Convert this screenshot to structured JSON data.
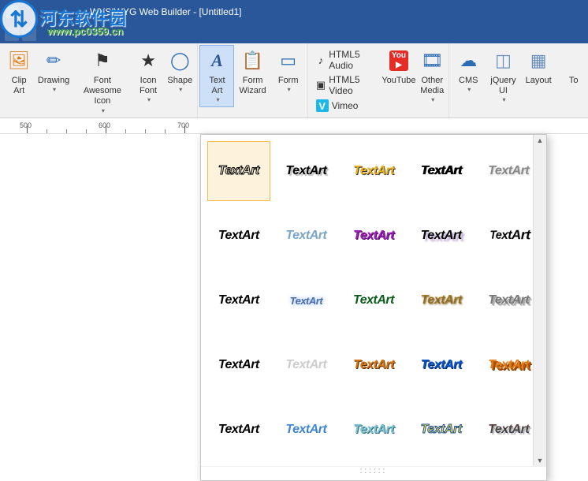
{
  "app": {
    "title": "WYSIWYG Web Builder - [Untitled1]"
  },
  "watermark": {
    "text": "河东软件园",
    "url": "www.pc0359.cn"
  },
  "ribbon": {
    "drawing_group": "Drawing",
    "clip_art": "Clip\nArt",
    "drawing": "Drawing",
    "font_awesome": "Font Awesome\nIcon",
    "icon_font": "Icon\nFont",
    "shape": "Shape",
    "text_art": "Text\nArt",
    "form_wizard": "Form\nWizard",
    "form": "Form",
    "html5_audio": "HTML5 Audio",
    "html5_video": "HTML5 Video",
    "vimeo": "Vimeo",
    "youtube": "YouTube",
    "other_media": "Other\nMedia",
    "cms": "CMS",
    "jquery_ui": "jQuery\nUI",
    "layout": "Layout",
    "to": "To"
  },
  "ruler": {
    "m500": "500",
    "m600": "600",
    "m700": "700"
  },
  "textart": {
    "label": "TextArt",
    "items": [
      "s1",
      "s2",
      "s3",
      "s4",
      "s5",
      "s6",
      "s7",
      "s8",
      "s9",
      "s10",
      "s11",
      "s12",
      "s13",
      "s14",
      "s15",
      "s16",
      "s17",
      "s18",
      "s19",
      "s20",
      "s21",
      "s22",
      "s23",
      "s24",
      "s25"
    ]
  }
}
